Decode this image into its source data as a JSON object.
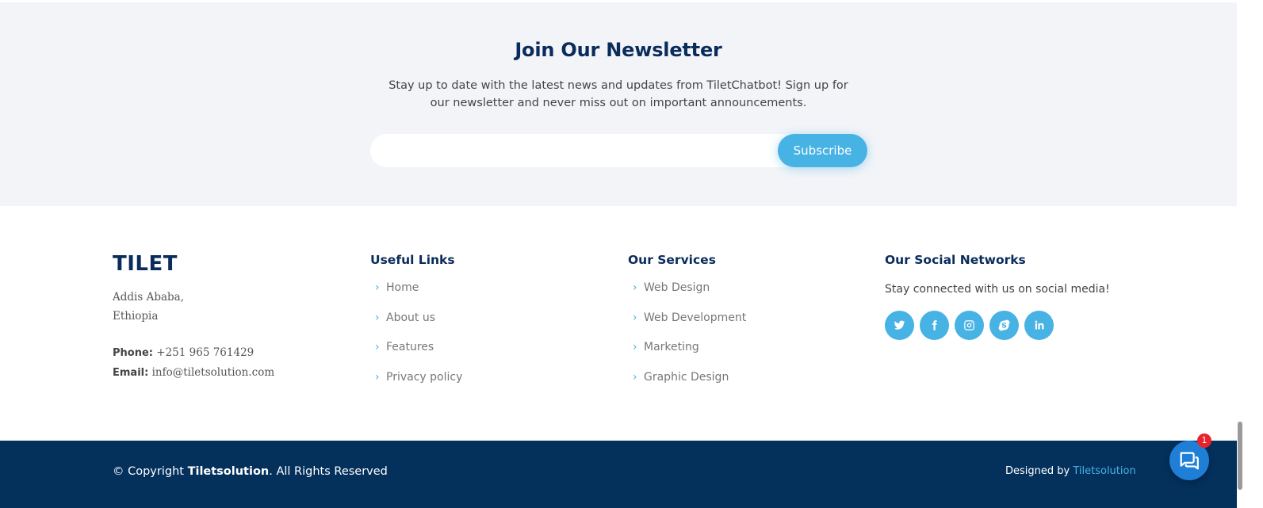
{
  "newsletter": {
    "title": "Join Our Newsletter",
    "text": "Stay up to date with the latest news and updates from TiletChatbot! Sign up for our newsletter and never miss out on important announcements.",
    "input_placeholder": "",
    "button_label": "Subscribe"
  },
  "brand": {
    "name": "TILET",
    "address_line1": "Addis Ababa,",
    "address_line2": "Ethiopia",
    "phone_label": "Phone:",
    "phone": "+251 965 761429",
    "email_label": "Email:",
    "email": "info@tiletsolution.com"
  },
  "useful_links": {
    "title": "Useful Links",
    "items": [
      "Home",
      "About us",
      "Features",
      "Privacy policy"
    ]
  },
  "services": {
    "title": "Our Services",
    "items": [
      "Web Design",
      "Web Development",
      "Marketing",
      "Graphic Design"
    ]
  },
  "social": {
    "title": "Our Social Networks",
    "text": "Stay connected with us on social media!",
    "icons": [
      "twitter-icon",
      "facebook-icon",
      "instagram-icon",
      "skype-icon",
      "linkedin-icon"
    ]
  },
  "bottom": {
    "copyright_prefix": "© Copyright ",
    "copyright_company": "Tiletsolution",
    "copyright_suffix": ". All Rights Reserved",
    "designed_prefix": "Designed by ",
    "designed_company": "Tiletsolution"
  },
  "chat": {
    "badge_count": "1"
  },
  "colors": {
    "accent": "#47b2e4",
    "navy": "#0a2c5c",
    "footer_bg": "#04305c",
    "newsletter_bg": "#f2f4f8"
  }
}
